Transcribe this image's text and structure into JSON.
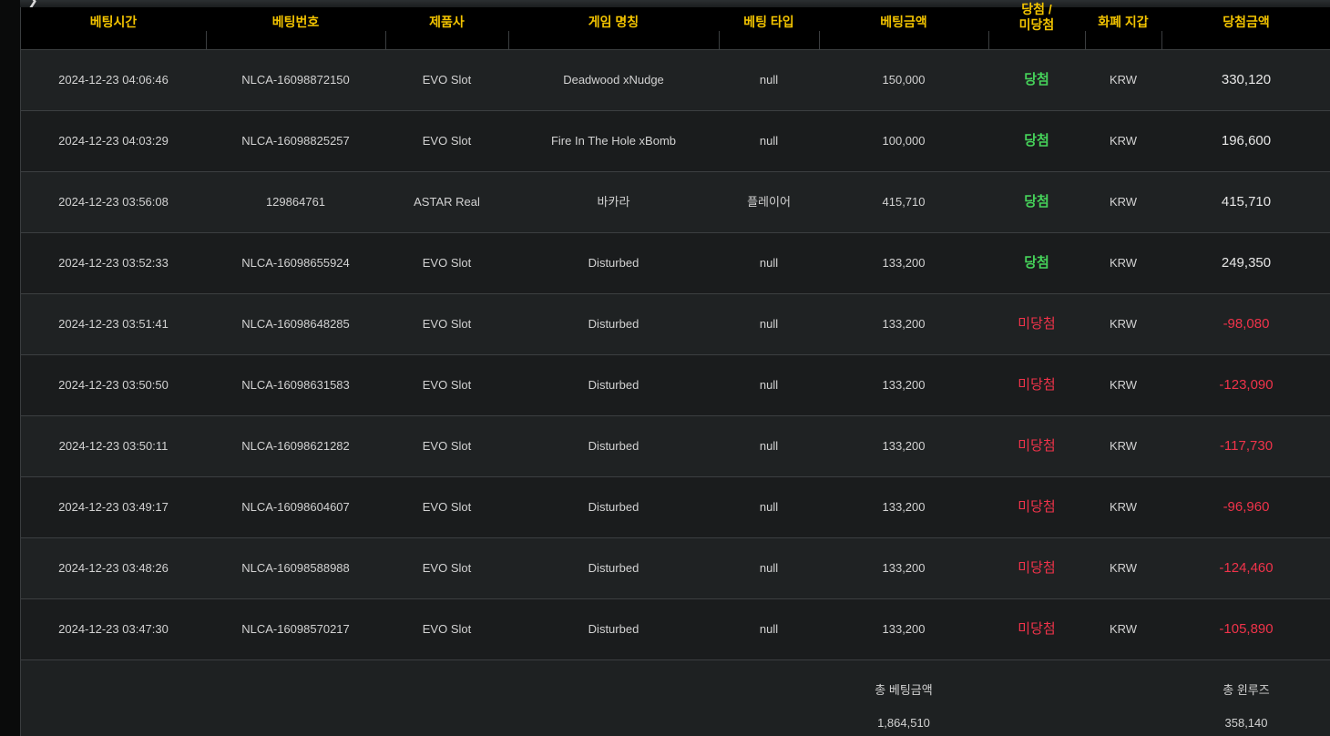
{
  "header": {
    "columns": [
      {
        "lines": [
          "베팅시간"
        ]
      },
      {
        "lines": [
          "베팅번호"
        ]
      },
      {
        "lines": [
          "제품사"
        ]
      },
      {
        "lines": [
          "게임 명칭"
        ]
      },
      {
        "lines": [
          "베팅 타입"
        ]
      },
      {
        "lines": [
          "베팅금액"
        ]
      },
      {
        "lines": [
          "당첨 /",
          "미당첨"
        ]
      },
      {
        "lines": [
          "화폐 지갑"
        ]
      },
      {
        "lines": [
          "당첨금액"
        ]
      }
    ]
  },
  "rows": [
    {
      "time": "2024-12-23 04:06:46",
      "bet_no": "NLCA-16098872150",
      "provider": "EVO Slot",
      "game": "Deadwood xNudge",
      "bet_type": "null",
      "bet_amount": "150,000",
      "result": "당첨",
      "result_status": "win",
      "wallet": "KRW",
      "win_amount": "330,120"
    },
    {
      "time": "2024-12-23 04:03:29",
      "bet_no": "NLCA-16098825257",
      "provider": "EVO Slot",
      "game": "Fire In The Hole xBomb",
      "bet_type": "null",
      "bet_amount": "100,000",
      "result": "당첨",
      "result_status": "win",
      "wallet": "KRW",
      "win_amount": "196,600"
    },
    {
      "time": "2024-12-23 03:56:08",
      "bet_no": "129864761",
      "provider": "ASTAR Real",
      "game": "바카라",
      "bet_type": "플레이어",
      "bet_amount": "415,710",
      "result": "당첨",
      "result_status": "win",
      "wallet": "KRW",
      "win_amount": "415,710"
    },
    {
      "time": "2024-12-23 03:52:33",
      "bet_no": "NLCA-16098655924",
      "provider": "EVO Slot",
      "game": "Disturbed",
      "bet_type": "null",
      "bet_amount": "133,200",
      "result": "당첨",
      "result_status": "win",
      "wallet": "KRW",
      "win_amount": "249,350"
    },
    {
      "time": "2024-12-23 03:51:41",
      "bet_no": "NLCA-16098648285",
      "provider": "EVO Slot",
      "game": "Disturbed",
      "bet_type": "null",
      "bet_amount": "133,200",
      "result": "미당첨",
      "result_status": "lose",
      "wallet": "KRW",
      "win_amount": "-98,080"
    },
    {
      "time": "2024-12-23 03:50:50",
      "bet_no": "NLCA-16098631583",
      "provider": "EVO Slot",
      "game": "Disturbed",
      "bet_type": "null",
      "bet_amount": "133,200",
      "result": "미당첨",
      "result_status": "lose",
      "wallet": "KRW",
      "win_amount": "-123,090"
    },
    {
      "time": "2024-12-23 03:50:11",
      "bet_no": "NLCA-16098621282",
      "provider": "EVO Slot",
      "game": "Disturbed",
      "bet_type": "null",
      "bet_amount": "133,200",
      "result": "미당첨",
      "result_status": "lose",
      "wallet": "KRW",
      "win_amount": "-117,730"
    },
    {
      "time": "2024-12-23 03:49:17",
      "bet_no": "NLCA-16098604607",
      "provider": "EVO Slot",
      "game": "Disturbed",
      "bet_type": "null",
      "bet_amount": "133,200",
      "result": "미당첨",
      "result_status": "lose",
      "wallet": "KRW",
      "win_amount": "-96,960"
    },
    {
      "time": "2024-12-23 03:48:26",
      "bet_no": "NLCA-16098588988",
      "provider": "EVO Slot",
      "game": "Disturbed",
      "bet_type": "null",
      "bet_amount": "133,200",
      "result": "미당첨",
      "result_status": "lose",
      "wallet": "KRW",
      "win_amount": "-124,460"
    },
    {
      "time": "2024-12-23 03:47:30",
      "bet_no": "NLCA-16098570217",
      "provider": "EVO Slot",
      "game": "Disturbed",
      "bet_type": "null",
      "bet_amount": "133,200",
      "result": "미당첨",
      "result_status": "lose",
      "wallet": "KRW",
      "win_amount": "-105,890"
    }
  ],
  "summary": {
    "total_bet_label": "총 베팅금액",
    "total_bet_value": "1,864,510",
    "total_winloss_label": "총 윈루즈",
    "total_winloss_value": "358,140"
  },
  "colors": {
    "header_text": "#f2c300",
    "win": "#46d25a",
    "lose": "#f0334a"
  }
}
